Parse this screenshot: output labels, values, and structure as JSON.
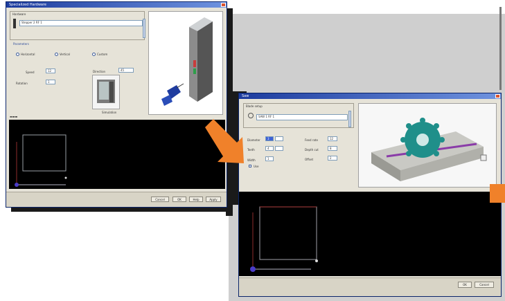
{
  "window1": {
    "title": "Specialized Hardware",
    "tab_label": "Hardware",
    "group_label": "Parameters",
    "preview_label": "Simulation",
    "pattern_value": "Stepper 2  RF  1",
    "option_a": "Horizontal",
    "option_b": "Vertical",
    "option_c": "Custom",
    "speed_label": "Speed",
    "rotation_label": "Rotation",
    "direction_label": "Direction",
    "speed_value": "12",
    "rotation_value": "1",
    "direction_value": "45",
    "buttons": [
      "Cancel",
      "OK",
      "Help",
      "Apply"
    ]
  },
  "window2": {
    "title": "Saw",
    "tab_label": "Blade setup",
    "pattern_value": "SAW 1   RF  1",
    "diameter_label": "Diameter",
    "teeth_label": "Teeth",
    "width_label": "Width",
    "feed_label": "Feed rate",
    "depth_label": "Depth cut",
    "offset_label": "Offset",
    "diameter_value": "3",
    "teeth_value": "4",
    "width_value": "1",
    "feed_value": "12",
    "depth_value": "8",
    "offset_value": "2",
    "check_label": "Use",
    "buttons": [
      "OK",
      "Cancel"
    ]
  },
  "colors": {
    "titlebar": "#1c3b9e",
    "arrow": "#f0812a",
    "saw_blade": "#1f8f8a",
    "canvas": "#000000"
  }
}
